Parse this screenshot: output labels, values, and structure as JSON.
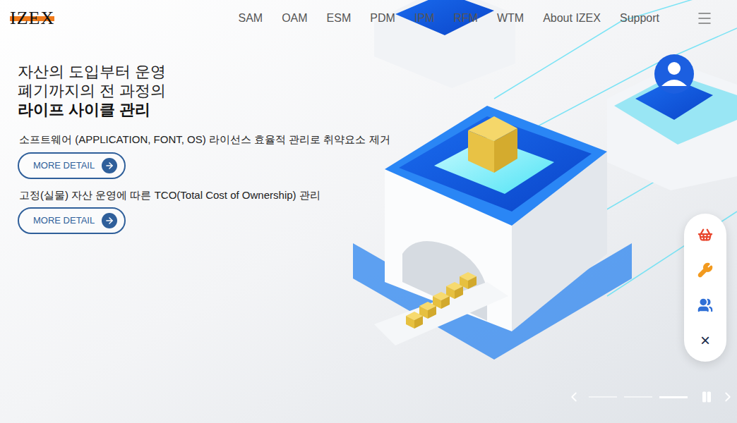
{
  "logo": "IZEX",
  "nav": [
    {
      "label": "SAM"
    },
    {
      "label": "OAM"
    },
    {
      "label": "ESM"
    },
    {
      "label": "PDM"
    },
    {
      "label": "IPM"
    },
    {
      "label": "RFM"
    },
    {
      "label": "WTM"
    },
    {
      "label": "About IZEX"
    },
    {
      "label": "Support"
    }
  ],
  "hero": {
    "headline": [
      "자산의 도입부터 운영",
      "폐기까지의 전 과정의"
    ],
    "headline_bold": "라이프 사이클 관리",
    "features": [
      {
        "description": "소프트웨어 (APPLICATION, FONT, OS) 라이선스 효율적 관리로 취약요소 제거",
        "button": "MORE DETAIL"
      },
      {
        "description": "고정(실물) 자산 운영에 따른 TCO(Total Cost of Ownership) 관리",
        "button": "MORE DETAIL"
      }
    ]
  },
  "quick_menu": {
    "items": [
      {
        "kind": "basket",
        "color": "#e8452c"
      },
      {
        "kind": "wrench",
        "color": "#f29a1f"
      },
      {
        "kind": "people",
        "color": "#2f6fd6"
      }
    ],
    "close": "×"
  },
  "slider": {
    "slides": [
      {
        "selected": false
      },
      {
        "selected": false
      },
      {
        "selected": true
      }
    ],
    "playing": true
  }
}
